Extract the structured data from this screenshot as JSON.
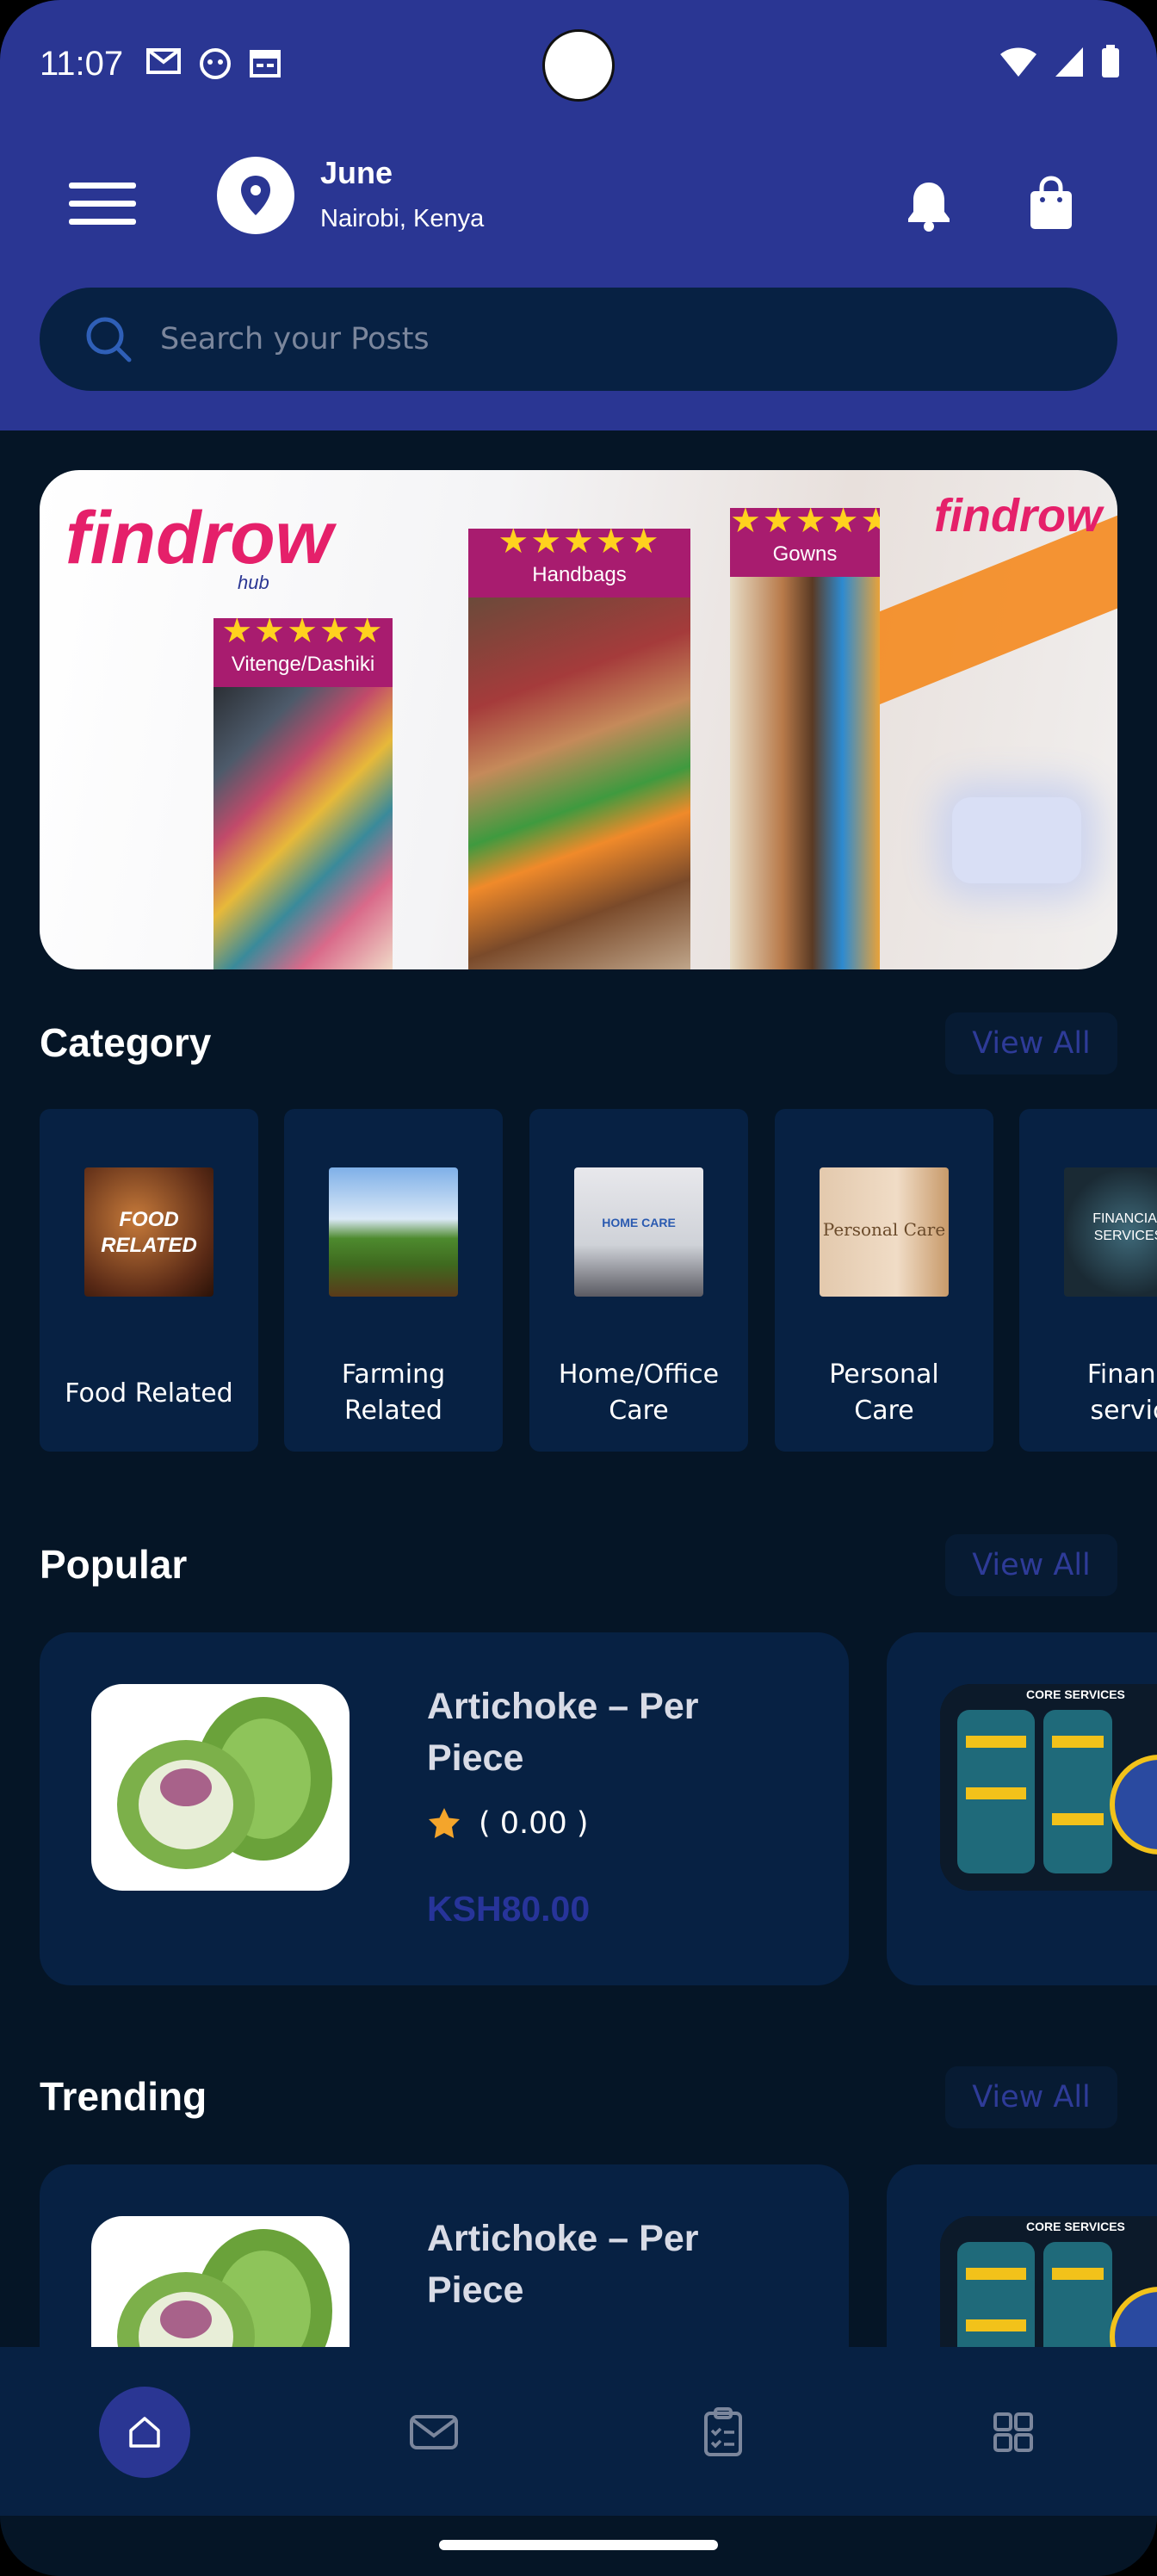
{
  "status_bar": {
    "time": "11:07",
    "icons": [
      "gmail-icon",
      "app-icon",
      "calendar-icon"
    ],
    "right_icons": [
      "wifi-icon",
      "signal-icon",
      "battery-icon"
    ]
  },
  "header": {
    "user_name": "June",
    "user_location": "Nairobi, Kenya",
    "menu_icon": "hamburger-menu-icon",
    "location_icon": "location-pin-icon",
    "notification_icon": "bell-icon",
    "cart_icon": "shopping-bag-icon"
  },
  "search": {
    "placeholder": "Search your Posts"
  },
  "banner": {
    "brand": "findrow",
    "brand_sub": "hub",
    "panels": [
      {
        "label": "Vitenge/Dashiki",
        "stars": "★★★★★"
      },
      {
        "label": "Handbags",
        "stars": "★★★★★"
      },
      {
        "label": "Gowns",
        "stars": "★★★★★"
      }
    ]
  },
  "category": {
    "title": "Category",
    "view_all": "View All",
    "items": [
      {
        "line1": "Food Related",
        "line2": "",
        "thumb_text": "FOOD RELATED"
      },
      {
        "line1": "Farming",
        "line2": "Related",
        "thumb_text": ""
      },
      {
        "line1": "Home/Office",
        "line2": "Care",
        "thumb_text": "HOME CARE"
      },
      {
        "line1": "Personal",
        "line2": "Care",
        "thumb_text": "Personal Care"
      },
      {
        "line1": "Financ",
        "line2": "servic",
        "thumb_text": "FINANCIAL SERVICES"
      }
    ]
  },
  "popular": {
    "title": "Popular",
    "view_all": "View All",
    "product": {
      "name": "Artichoke – Per Piece",
      "rating": "( 0.00 )",
      "price": "KSH80.00"
    },
    "peek_title": "CORE SERVICES"
  },
  "trending": {
    "title": "Trending",
    "view_all": "View All",
    "product": {
      "name": "Artichoke – Per Piece"
    },
    "peek_title": "CORE SERVICES"
  },
  "bottom_nav": {
    "items": [
      "home-icon",
      "mail-icon",
      "clipboard-icon",
      "grid-icon"
    ],
    "active": 0
  },
  "colors": {
    "header_bg": "#2a3693",
    "page_bg": "#051526",
    "card_bg": "#072143",
    "accent": "#2a3693",
    "star": "#f4a52b"
  }
}
